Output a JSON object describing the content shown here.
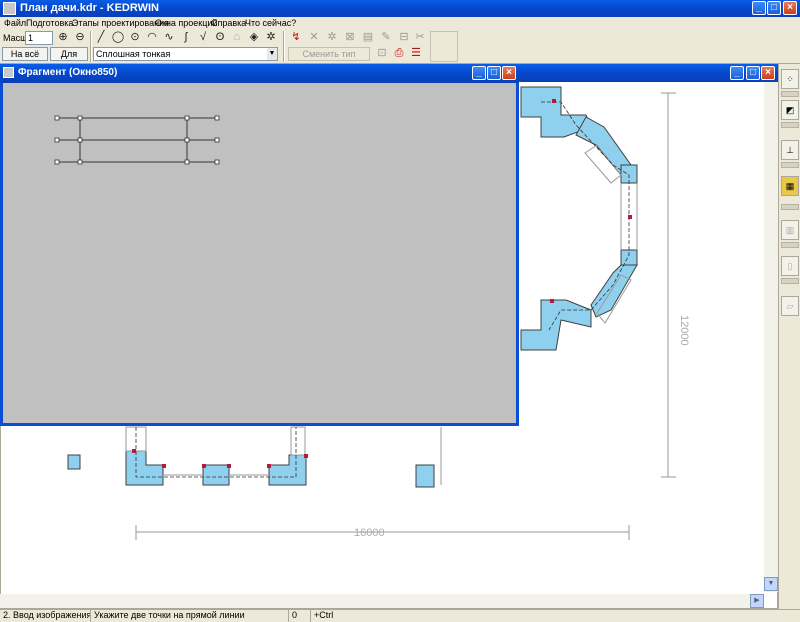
{
  "app": {
    "title": "План дачи.kdr - KEDRWIN"
  },
  "menu": [
    "Файл",
    "Подготовка",
    "Этапы проектирования",
    "Окна проекций",
    "Справка",
    "Что сейчас?"
  ],
  "toolbar": {
    "scale_label": "Масшт",
    "scale_value": "1",
    "fit_window_button": "На всё окно",
    "for_all_button": "Для всех",
    "line_type_value": "Сплошная тонкая",
    "change_line_type_button": "Сменить тип линии"
  },
  "fragment_window": {
    "title": "Фрагмент (Окно850)"
  },
  "drawing": {
    "dimension_horizontal": "16000",
    "dimension_vertical": "12000"
  },
  "status": {
    "mode": "2. Ввод изображения",
    "hint": "Укажите две точки на прямой линии",
    "counter": "0",
    "modifier": "+Ctrl"
  },
  "colors": {
    "titlebar": "#0a5ce6",
    "wall_fill": "#8fd0ee",
    "point_marker": "#b01c3c"
  }
}
